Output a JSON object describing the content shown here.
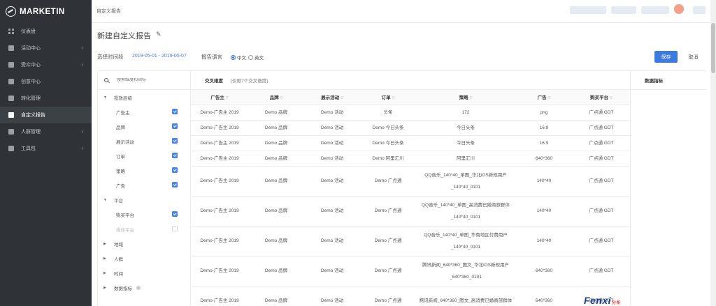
{
  "app": {
    "name": "MARKETIN"
  },
  "breadcrumb": "自定义报告",
  "sidebar": {
    "items": [
      {
        "label": "仪表盘",
        "icon": "dashboard-icon",
        "chevron": false,
        "active": false
      },
      {
        "label": "活动中心",
        "icon": "campaign-icon",
        "chevron": true,
        "active": false
      },
      {
        "label": "受众中心",
        "icon": "audience-icon",
        "chevron": true,
        "active": false
      },
      {
        "label": "创意中心",
        "icon": "creative-icon",
        "chevron": false,
        "active": false
      },
      {
        "label": "转化管理",
        "icon": "conversion-icon",
        "chevron": false,
        "active": false
      },
      {
        "label": "自定义报告",
        "icon": "report-icon",
        "chevron": false,
        "active": true
      },
      {
        "label": "人群管理",
        "icon": "crowd-icon",
        "chevron": true,
        "active": false
      },
      {
        "label": "工具包",
        "icon": "toolkit-icon",
        "chevron": true,
        "active": false
      }
    ]
  },
  "page": {
    "title": "新建自定义报告",
    "range_label": "选择时间段",
    "range_value": "2019-05-01 - 2019-05-07",
    "lang_label": "报告语言",
    "lang_options": [
      "中文",
      "英文"
    ],
    "lang_selected": "中文",
    "save_label": "保存",
    "cancel_label": "取消"
  },
  "filter": {
    "search_placeholder": "搜索维度和指标",
    "groups": [
      {
        "label": "投放层级",
        "caret": "▼",
        "children": [
          {
            "label": "广告主",
            "checked": true
          },
          {
            "label": "品牌",
            "checked": true
          },
          {
            "label": "展示活动",
            "checked": true
          },
          {
            "label": "订单",
            "checked": true
          },
          {
            "label": "策略",
            "checked": true
          },
          {
            "label": "广告",
            "checked": true
          }
        ]
      },
      {
        "label": "平台",
        "caret": "▼",
        "children": [
          {
            "label": "购买平台",
            "checked": true
          },
          {
            "label": "媒体平台",
            "checked": false,
            "disabled": true
          }
        ]
      },
      {
        "label": "地域",
        "caret": "▶",
        "children": []
      },
      {
        "label": "人群",
        "caret": "▶",
        "children": []
      },
      {
        "label": "时间",
        "caret": "▶",
        "children": []
      },
      {
        "label": "数据指标",
        "caret": "▶",
        "children": [],
        "info": true
      }
    ]
  },
  "table": {
    "title": "交叉维度",
    "hint": "(仅限7个交叉维度)",
    "metrics_header": "数据指标",
    "columns": [
      "广告主",
      "品牌",
      "展示活动",
      "订单",
      "策略",
      "广告",
      "购买平台"
    ],
    "rows": [
      {
        "tall": false,
        "cells": [
          "Demo-广告主 2019",
          "Demo 品牌",
          "Demo 活动",
          "头条",
          "172",
          "png",
          "广点通 GDT"
        ]
      },
      {
        "tall": false,
        "cells": [
          "Demo-广告主 2019",
          "Demo 品牌",
          "Demo 活动",
          "Demo 今日头条",
          "今日头条",
          "16:9",
          "广点通 GDT"
        ]
      },
      {
        "tall": false,
        "cells": [
          "Demo-广告主 2019",
          "Demo 品牌",
          "Demo 活动",
          "Demo 今日头条",
          "今日头条",
          "16:9",
          "广点通 GDT"
        ]
      },
      {
        "tall": false,
        "cells": [
          "Demo-广告主 2019",
          "Demo 品牌",
          "Demo 活动",
          "Demo 阿里汇川",
          "阿里汇川",
          "640*360",
          "广点通 GDT"
        ]
      },
      {
        "tall": true,
        "cells": [
          "Demo-广告主 2019",
          "Demo 品牌",
          "Demo 活动",
          "Demo 广点通",
          "QQ音乐_140*40_单图_华北iOS新规用户_140*40_0101",
          "140*40",
          "广点通 GDT"
        ]
      },
      {
        "tall": true,
        "cells": [
          "Demo-广告主 2019",
          "Demo 品牌",
          "Demo 活动",
          "Demo 广点通",
          "QQ音乐_140*40_单图_高消费已婚商旅群体_140*40_0101",
          "140*40",
          "广点通 GDT"
        ]
      },
      {
        "tall": true,
        "cells": [
          "Demo-广告主 2019",
          "Demo 品牌",
          "Demo 活动",
          "Demo 广点通",
          "QQ音乐_140*40_单图_华南地区付费用户_140*40_0101",
          "140*40",
          "广点通 GDT"
        ]
      },
      {
        "tall": true,
        "cells": [
          "Demo-广告主 2019",
          "Demo 品牌",
          "Demo 活动",
          "Demo 广点通",
          "腾讯新闻_640*360_图文_华北iOS新规用户_640*360_0101",
          "640*360",
          "广点通 GDT"
        ]
      },
      {
        "tall": true,
        "cells": [
          "Demo-广告主 2019",
          "Demo 品牌",
          "Demo 活动",
          "Demo 广点通",
          "腾讯新闻_640*360_图文_高消费已婚商旅群体",
          "640*360",
          "广点通 GDT"
        ]
      }
    ]
  },
  "watermark": {
    "text": "Fenxi",
    "suffix": "分析"
  },
  "colors": {
    "sidebar_bg": "#2f3337",
    "accent": "#3d7ae0",
    "checkbox": "#4a84e6"
  }
}
